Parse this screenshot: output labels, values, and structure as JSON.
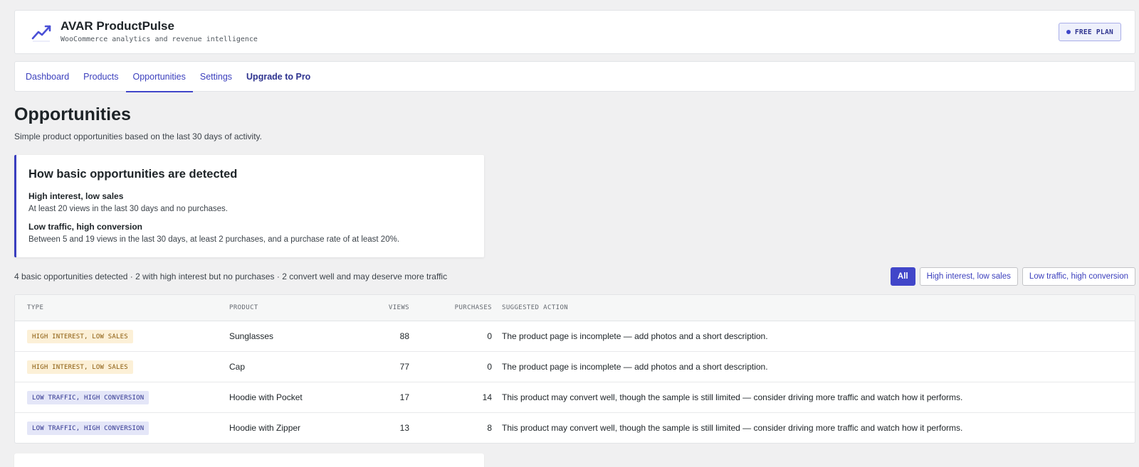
{
  "header": {
    "title": "AVAR ProductPulse",
    "subtitle": "WooCommerce analytics and revenue intelligence",
    "plan_badge": "FREE PLAN",
    "logo_icon": "trend-line-icon"
  },
  "nav": {
    "tabs": [
      {
        "label": "Dashboard"
      },
      {
        "label": "Products"
      },
      {
        "label": "Opportunities",
        "active": true
      },
      {
        "label": "Settings"
      },
      {
        "label": "Upgrade to Pro"
      }
    ]
  },
  "page": {
    "title": "Opportunities",
    "description": "Simple product opportunities based on the last 30 days of activity."
  },
  "info_card": {
    "title": "How basic opportunities are detected",
    "criteria": [
      {
        "title": "High interest, low sales",
        "description": "At least 20 views in the last 30 days and no purchases."
      },
      {
        "title": "Low traffic, high conversion",
        "description": "Between 5 and 19 views in the last 30 days, at least 2 purchases, and a purchase rate of at least 20%."
      }
    ]
  },
  "summary": "4 basic opportunities detected · 2 with high interest but no purchases · 2 convert well and may deserve more traffic",
  "filters": [
    {
      "label": "All",
      "active": true
    },
    {
      "label": "High interest, low sales"
    },
    {
      "label": "Low traffic, high conversion"
    }
  ],
  "table": {
    "columns": [
      "TYPE",
      "PRODUCT",
      "VIEWS",
      "PURCHASES",
      "SUGGESTED ACTION"
    ],
    "rows": [
      {
        "type": "HIGH INTEREST, LOW SALES",
        "product": "Sunglasses",
        "views": "88",
        "purchases": "0",
        "action": "The product page is incomplete — add photos and a short description."
      },
      {
        "type": "HIGH INTEREST, LOW SALES",
        "product": "Cap",
        "views": "77",
        "purchases": "0",
        "action": "The product page is incomplete — add photos and a short description."
      },
      {
        "type": "LOW TRAFFIC, HIGH CONVERSION",
        "product": "Hoodie with Pocket",
        "views": "17",
        "purchases": "14",
        "action": "This product may convert well, though the sample is still limited — consider driving more traffic and watch how it performs."
      },
      {
        "type": "LOW TRAFFIC, HIGH CONVERSION",
        "product": "Hoodie with Zipper",
        "views": "13",
        "purchases": "8",
        "action": "This product may convert well, though the sample is still limited — consider driving more traffic and watch how it performs."
      }
    ]
  },
  "colors": {
    "accent": "#4146c9",
    "high_interest_tag_bg": "#fcf0d7",
    "low_traffic_tag_bg": "#e4e6f8"
  }
}
